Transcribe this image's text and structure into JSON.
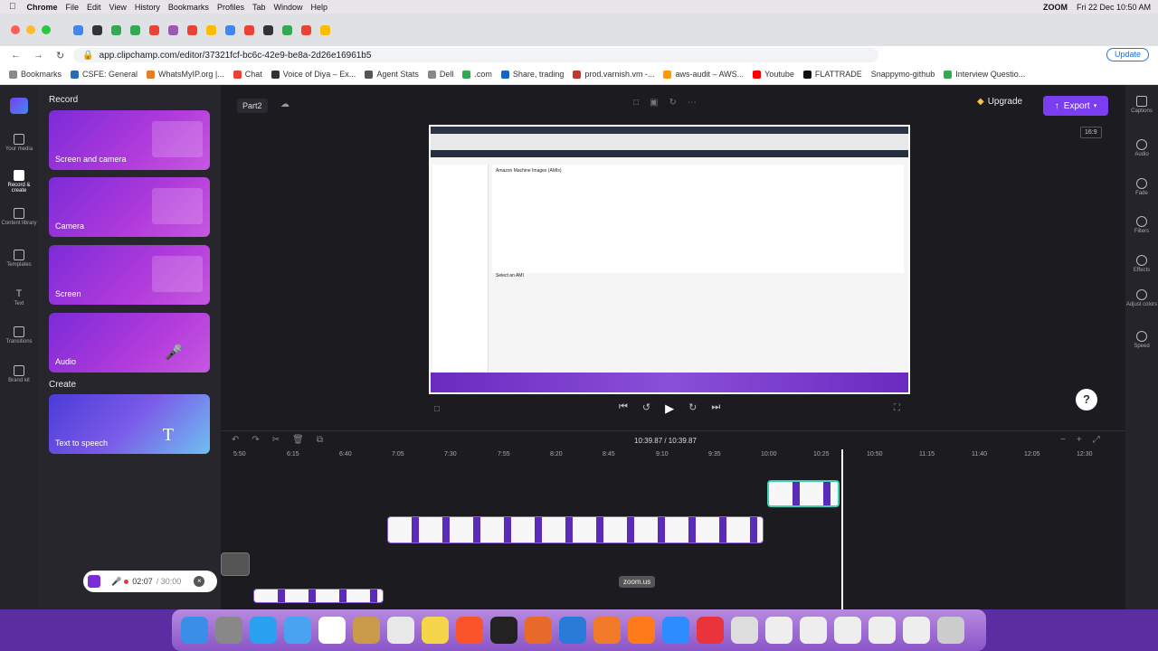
{
  "menubar": {
    "apple": "",
    "items": [
      "Chrome",
      "File",
      "Edit",
      "View",
      "History",
      "Bookmarks",
      "Profiles",
      "Tab",
      "Window",
      "Help"
    ],
    "zoom": "ZOOM",
    "datetime": "Fri 22 Dec  10:50 AM"
  },
  "browser": {
    "url": "app.clipchamp.com/editor/37321fcf-bc6c-42e9-be8a-2d26e16961b5",
    "update_label": "Update",
    "bookmarks": [
      "Bookmarks",
      "CSFE: General",
      "WhatsMyIP.org |...",
      "Chat",
      "Voice of Diya – Ex...",
      "Agent Stats",
      "Dell",
      ".com",
      "Share, trading",
      "prod.varnish.vm -...",
      "aws-audit – AWS...",
      "Youtube",
      "FLATTRADE",
      "Snappymo-github",
      "Interview Questio..."
    ]
  },
  "left_rail": {
    "items": [
      {
        "label": "Your media"
      },
      {
        "label": "Record & create"
      },
      {
        "label": "Content library"
      },
      {
        "label": "Templates"
      },
      {
        "label": "Text"
      },
      {
        "label": "Transitions"
      },
      {
        "label": "Brand kit"
      }
    ]
  },
  "record_panel": {
    "record_title": "Record",
    "create_title": "Create",
    "cards": [
      "Screen and camera",
      "Camera",
      "Screen",
      "Audio"
    ],
    "tts_card": "Text to speech",
    "recording": {
      "elapsed": "02:07",
      "limit": "/ 30:00"
    }
  },
  "editor": {
    "project_name": "Part2",
    "upgrade_label": "Upgrade",
    "export_label": "Export",
    "aspect_ratio": "16:9",
    "preview": {
      "page_title": "Amazon Machine Images (AMIs)",
      "panel_title": "Select an AMI"
    },
    "timecode": "10:39.87 / 10:39.87",
    "ruler_ticks": [
      "5:50",
      "6:15",
      "6:40",
      "7:05",
      "7:30",
      "7:55",
      "8:20",
      "8:45",
      "9:10",
      "9:35",
      "10:00",
      "10:25",
      "10:50",
      "11:15",
      "11:40",
      "12:05",
      "12:30"
    ],
    "tooltip": "zoom.us"
  },
  "right_rail": {
    "items": [
      "Captions",
      "Audio",
      "Fade",
      "Filters",
      "Effects",
      "Adjust colors",
      "Speed"
    ]
  },
  "colors": {
    "accent": "#7b3df0",
    "card_gradient_start": "#7b2bd8",
    "record_dot": "#e53935"
  }
}
